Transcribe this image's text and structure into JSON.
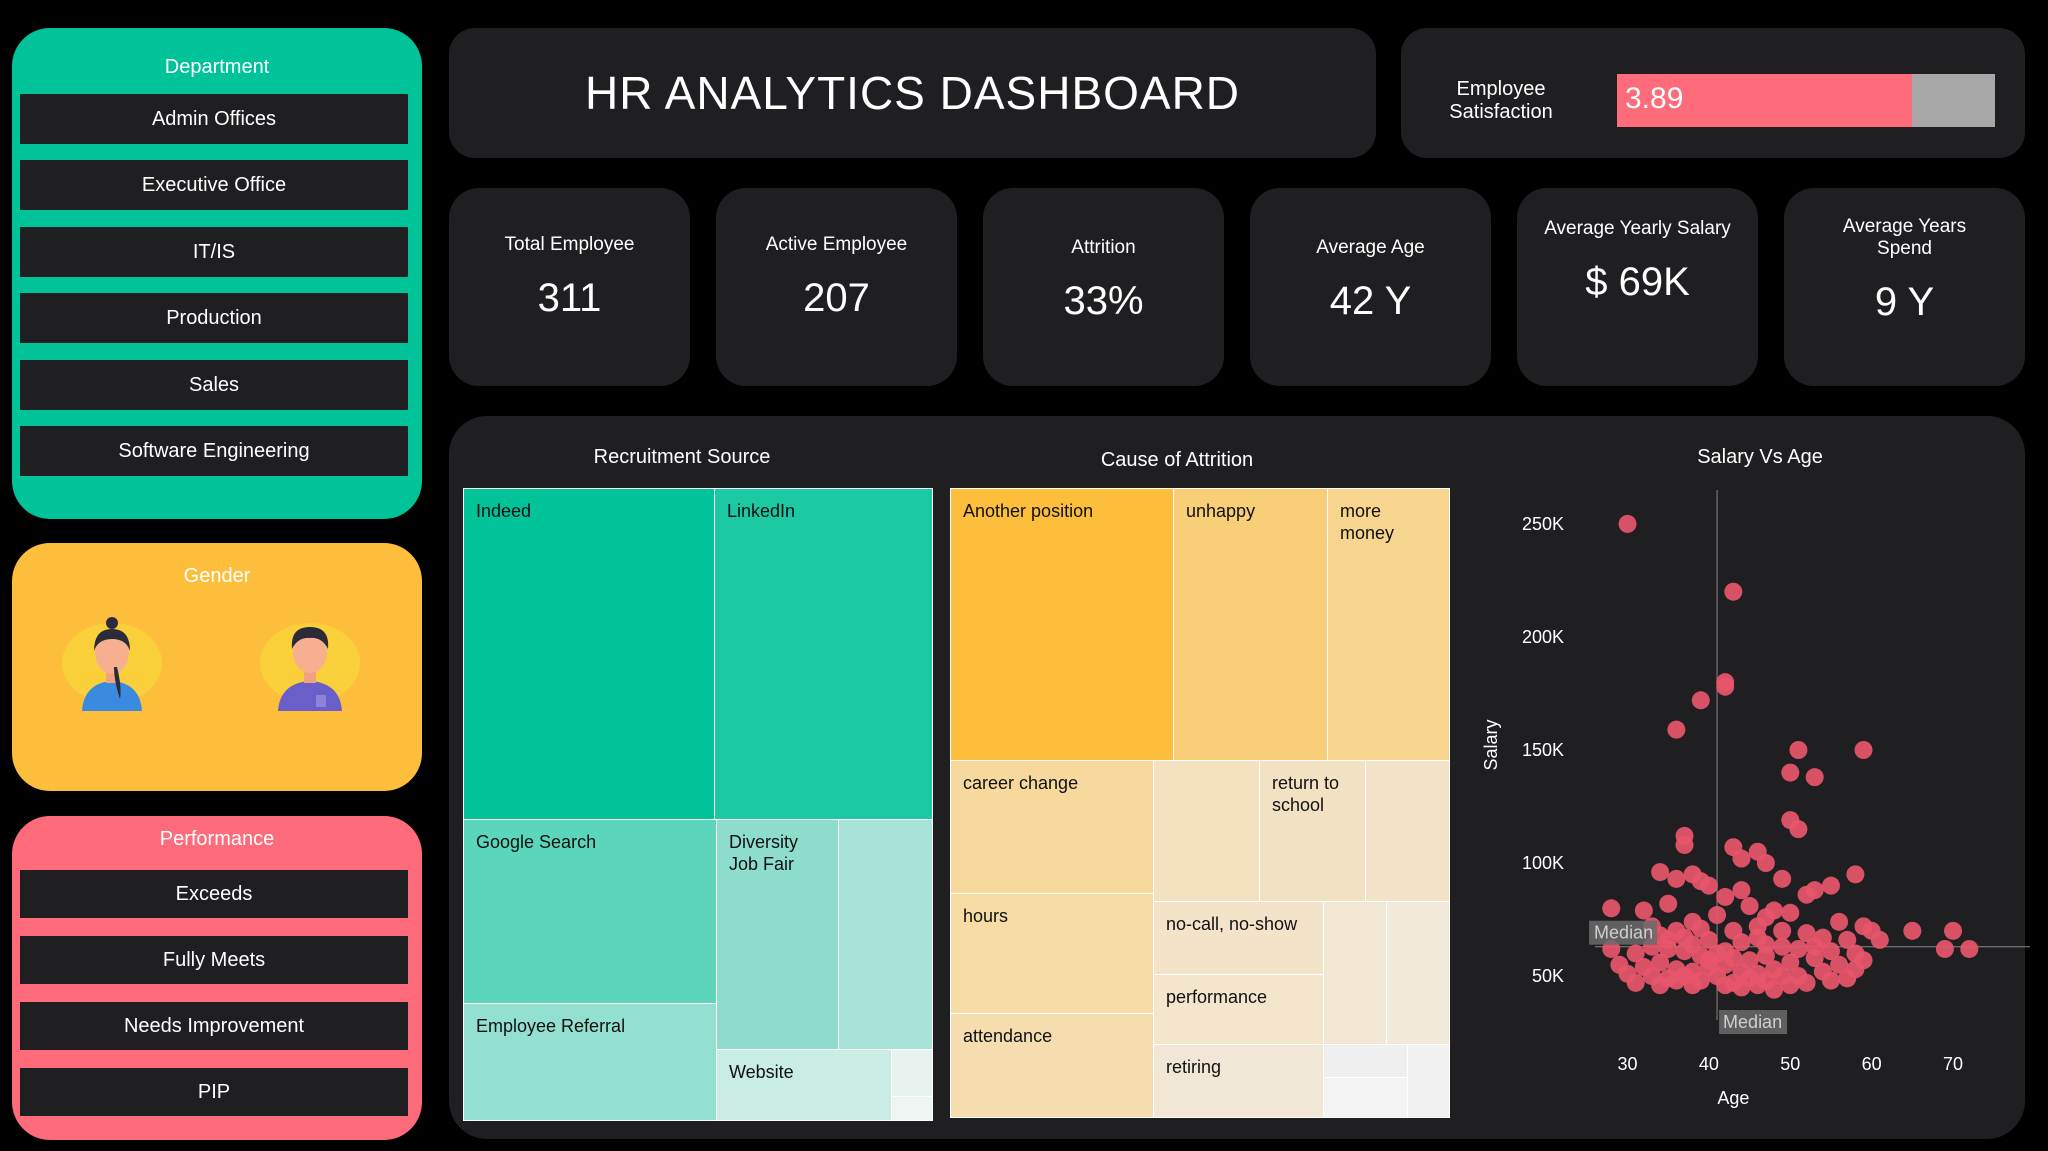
{
  "department": {
    "title": "Department",
    "items": [
      "Admin Offices",
      "Executive Office",
      "IT/IS",
      "Production",
      "Sales",
      "Software Engineering"
    ]
  },
  "gender": {
    "title": "Gender"
  },
  "performance": {
    "title": "Performance",
    "items": [
      "Exceeds",
      "Fully Meets",
      "Needs Improvement",
      "PIP"
    ]
  },
  "header": {
    "title": "HR ANALYTICS DASHBOARD"
  },
  "satisfaction": {
    "label_line1": "Employee",
    "label_line2": "Satisfaction",
    "value": "3.89",
    "fraction": 0.78
  },
  "kpis": [
    {
      "label": "Total Employee",
      "value": "311"
    },
    {
      "label": "Active Employee",
      "value": "207"
    },
    {
      "label": "Attrition",
      "value": "33%"
    },
    {
      "label": "Average Age",
      "value": "42 Y"
    },
    {
      "label": "Average Yearly Salary",
      "value": "$ 69K"
    },
    {
      "label_line1": "Average Years",
      "label_line2": "Spend",
      "value": "9 Y"
    }
  ],
  "recruitment": {
    "title": "Recruitment Source",
    "tiles": [
      "Indeed",
      "LinkedIn",
      "Google Search",
      "Diversity",
      "Job Fair",
      "Employee Referral",
      "Website"
    ]
  },
  "attrition": {
    "title": "Cause of Attrition",
    "tiles": [
      "Another position",
      "unhappy",
      "more",
      "money",
      "career change",
      "return to",
      "school",
      "hours",
      "no-call, no-show",
      "performance",
      "attendance",
      "retiring"
    ]
  },
  "colors": {
    "teal": "#00c39a",
    "yellow": "#fdbe3c",
    "pink": "#fe6b7a",
    "panel": "#1f1e21",
    "dot": "#e8566b"
  },
  "chart_data": {
    "type": "scatter",
    "title": "Salary Vs Age",
    "xlabel": "Age",
    "ylabel": "Salary",
    "xlim": [
      26,
      77
    ],
    "ylim": [
      35000,
      265000
    ],
    "xticks": [
      30,
      40,
      50,
      60,
      70
    ],
    "xtick_labels": [
      "30",
      "40",
      "50",
      "60",
      "70"
    ],
    "yticks": [
      50000,
      100000,
      150000,
      200000,
      250000
    ],
    "ytick_labels": [
      "50K",
      "100K",
      "150K",
      "200K",
      "250K"
    ],
    "median_x": 41,
    "median_y": 63000,
    "median_label": "Median",
    "points": [
      [
        30,
        250000
      ],
      [
        43,
        220000
      ],
      [
        42,
        180000
      ],
      [
        42,
        178000
      ],
      [
        39,
        172000
      ],
      [
        36,
        159000
      ],
      [
        51,
        150000
      ],
      [
        59,
        150000
      ],
      [
        50,
        140000
      ],
      [
        53,
        138000
      ],
      [
        50,
        119000
      ],
      [
        51,
        115000
      ],
      [
        37,
        112000
      ],
      [
        37,
        108000
      ],
      [
        43,
        107000
      ],
      [
        46,
        105000
      ],
      [
        44,
        102000
      ],
      [
        47,
        100000
      ],
      [
        34,
        96000
      ],
      [
        38,
        95000
      ],
      [
        36,
        93000
      ],
      [
        39,
        92000
      ],
      [
        40,
        90000
      ],
      [
        44,
        88000
      ],
      [
        49,
        93000
      ],
      [
        55,
        90000
      ],
      [
        58,
        95000
      ],
      [
        53,
        88000
      ],
      [
        52,
        86000
      ],
      [
        42,
        85000
      ],
      [
        28,
        80000
      ],
      [
        32,
        79000
      ],
      [
        35,
        82000
      ],
      [
        45,
        81000
      ],
      [
        48,
        79000
      ],
      [
        41,
        77000
      ],
      [
        47,
        76000
      ],
      [
        50,
        78000
      ],
      [
        56,
        74000
      ],
      [
        59,
        72000
      ],
      [
        38,
        74000
      ],
      [
        33,
        72000
      ],
      [
        36,
        70000
      ],
      [
        39,
        71000
      ],
      [
        43,
        70000
      ],
      [
        46,
        72000
      ],
      [
        49,
        70000
      ],
      [
        52,
        69000
      ],
      [
        54,
        67000
      ],
      [
        57,
        66000
      ],
      [
        65,
        70000
      ],
      [
        70,
        70000
      ],
      [
        60,
        70000
      ],
      [
        61,
        66000
      ],
      [
        69,
        62000
      ],
      [
        72,
        62000
      ],
      [
        34,
        68000
      ],
      [
        37,
        67000
      ],
      [
        40,
        66000
      ],
      [
        44,
        65000
      ],
      [
        47,
        64000
      ],
      [
        49,
        63000
      ],
      [
        51,
        62000
      ],
      [
        55,
        61000
      ],
      [
        58,
        60000
      ],
      [
        59,
        57000
      ],
      [
        28,
        62000
      ],
      [
        31,
        60000
      ],
      [
        33,
        63000
      ],
      [
        35,
        62000
      ],
      [
        37,
        61000
      ],
      [
        39,
        59000
      ],
      [
        41,
        60000
      ],
      [
        43,
        58000
      ],
      [
        45,
        57000
      ],
      [
        47,
        59000
      ],
      [
        50,
        56000
      ],
      [
        53,
        58000
      ],
      [
        56,
        55000
      ],
      [
        58,
        53000
      ],
      [
        29,
        55000
      ],
      [
        32,
        54000
      ],
      [
        34,
        56000
      ],
      [
        36,
        53000
      ],
      [
        38,
        52000
      ],
      [
        40,
        54000
      ],
      [
        42,
        55000
      ],
      [
        44,
        52000
      ],
      [
        46,
        51000
      ],
      [
        48,
        53000
      ],
      [
        51,
        50000
      ],
      [
        54,
        52000
      ],
      [
        57,
        49000
      ],
      [
        30,
        51000
      ],
      [
        33,
        50000
      ],
      [
        35,
        49000
      ],
      [
        37,
        50000
      ],
      [
        39,
        48000
      ],
      [
        41,
        50000
      ],
      [
        43,
        47000
      ],
      [
        45,
        49000
      ],
      [
        47,
        48000
      ],
      [
        49,
        50000
      ],
      [
        52,
        47000
      ],
      [
        55,
        48000
      ],
      [
        31,
        47000
      ],
      [
        34,
        46000
      ],
      [
        36,
        48000
      ],
      [
        38,
        46000
      ],
      [
        42,
        46000
      ],
      [
        44,
        45000
      ],
      [
        46,
        46000
      ],
      [
        48,
        44000
      ],
      [
        50,
        46000
      ],
      [
        40,
        57000
      ],
      [
        42,
        61000
      ],
      [
        38,
        64000
      ],
      [
        35,
        66000
      ],
      [
        46,
        67000
      ],
      [
        53,
        63000
      ]
    ]
  }
}
